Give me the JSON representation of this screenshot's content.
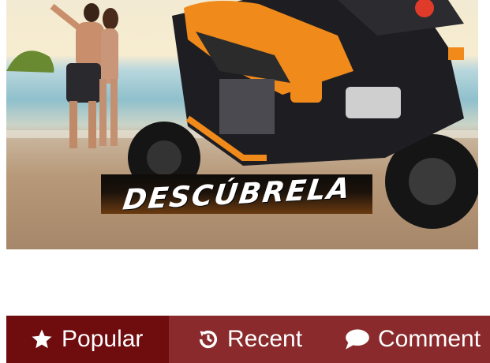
{
  "promo": {
    "banner_text": "DESCÚBRELA"
  },
  "tabs": [
    {
      "label": "Popular",
      "icon": "star-icon",
      "active": true
    },
    {
      "label": "Recent",
      "icon": "history-icon",
      "active": false
    },
    {
      "label": "Comment",
      "icon": "comment-icon",
      "active": false
    }
  ],
  "colors": {
    "tab_bar": "#8a2a2c",
    "tab_active": "#6e0c0e",
    "motorcycle_accent": "#f08a1a"
  }
}
